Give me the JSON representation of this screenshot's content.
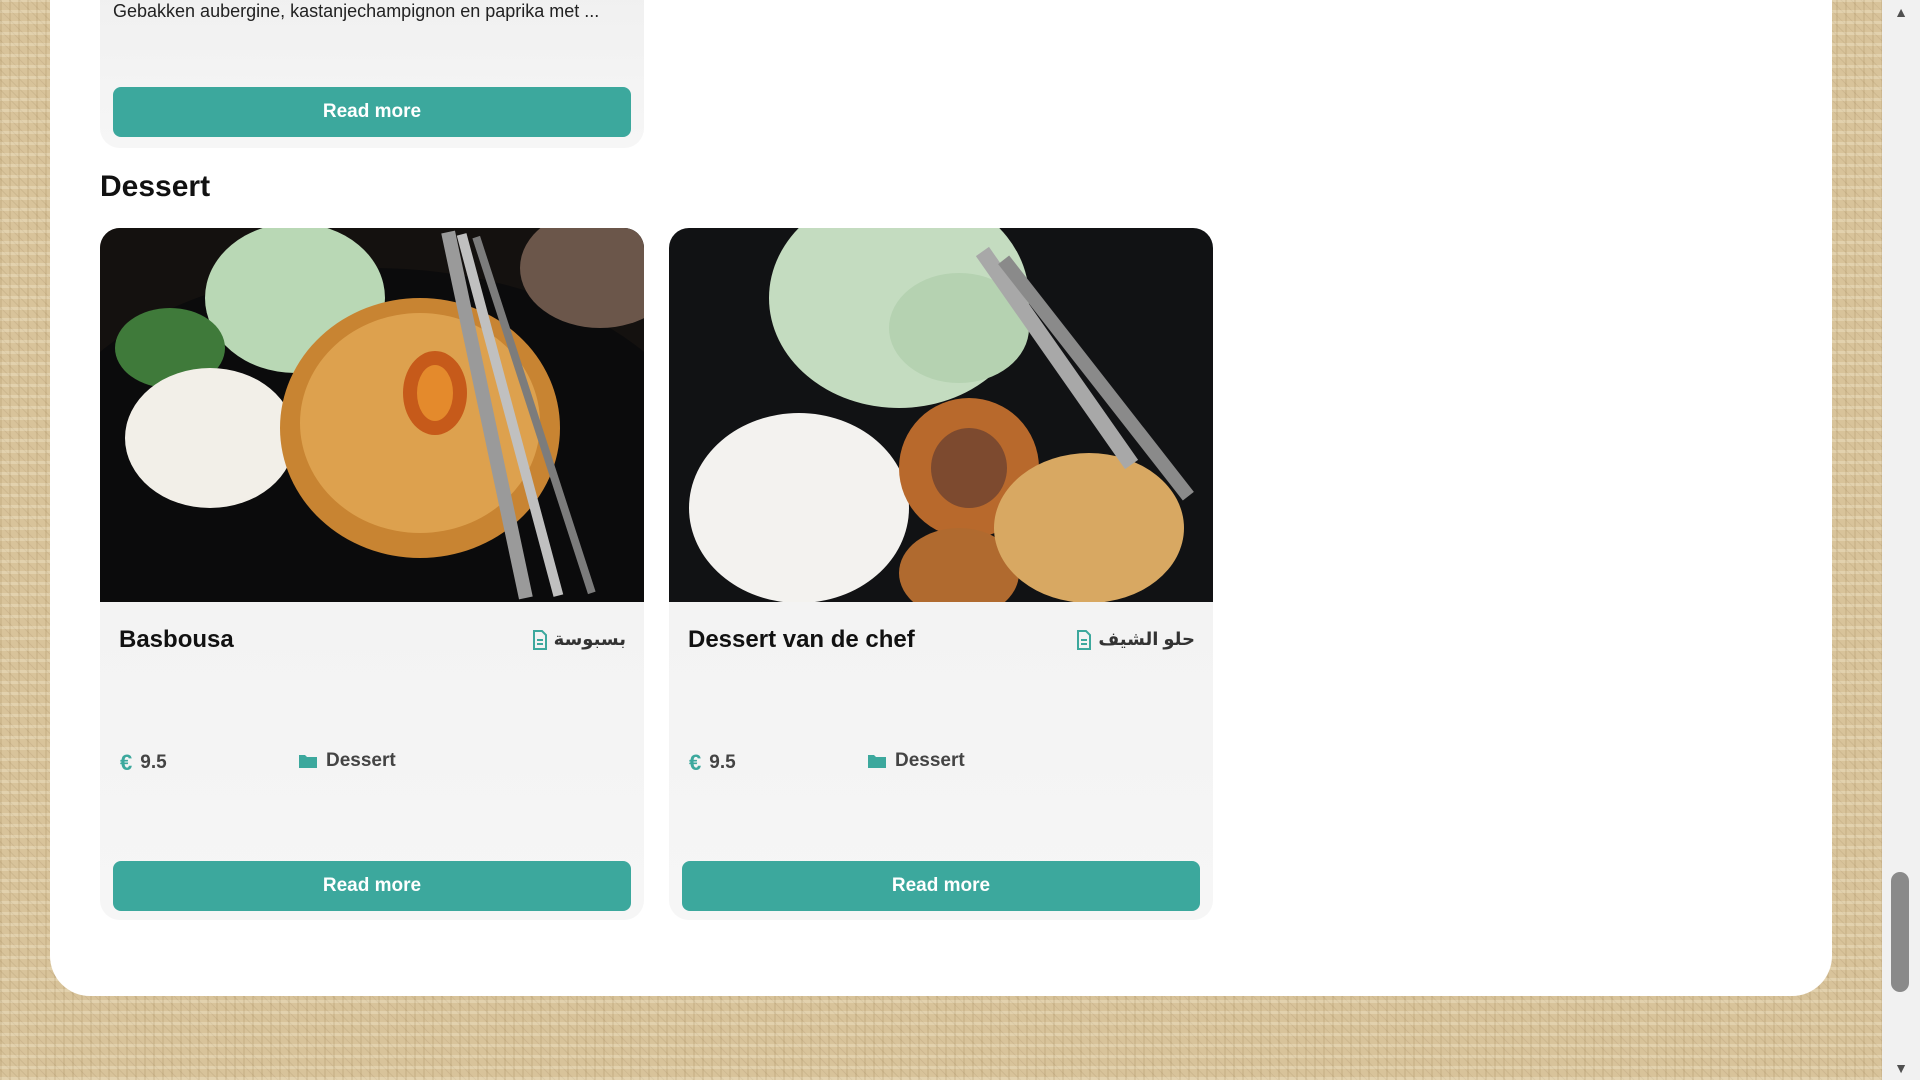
{
  "top_card": {
    "description": "Gebakken aubergine, kastanjechampignon en paprika met ...",
    "button_label": "Read more"
  },
  "section": {
    "title": "Dessert"
  },
  "dishes": [
    {
      "name": "Basbousa",
      "arabic_name": "بسبوسة",
      "price": "9.5",
      "category": "Dessert",
      "button_label": "Read more"
    },
    {
      "name": "Dessert van de chef",
      "arabic_name": "حلو الشيف",
      "price": "9.5",
      "category": "Dessert",
      "button_label": "Read more"
    }
  ],
  "icons": {
    "price": "euro-icon",
    "category": "folder-icon",
    "arabic_label": "document-icon"
  },
  "colors": {
    "accent": "#3ca89d",
    "panel": "#ffffff",
    "card": "#f3f3f3"
  }
}
